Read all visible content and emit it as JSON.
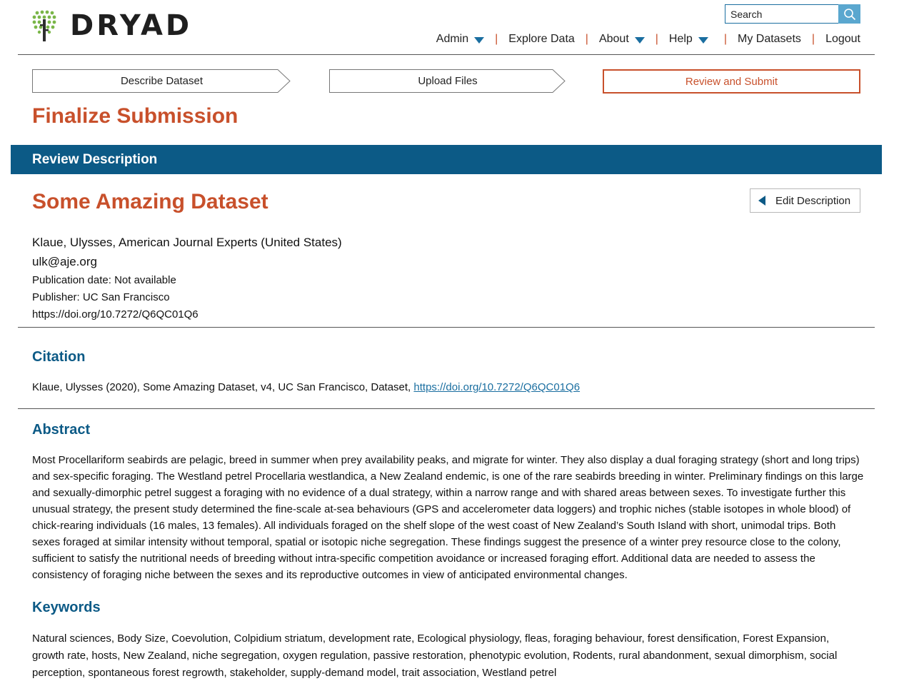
{
  "header": {
    "logo_text": "DRYAD",
    "search": {
      "placeholder": "Search"
    },
    "nav": {
      "admin": "Admin",
      "explore": "Explore Data",
      "about": "About",
      "help": "Help",
      "my_datasets": "My Datasets",
      "logout": "Logout"
    }
  },
  "steps": {
    "describe": "Describe Dataset",
    "upload": "Upload Files",
    "review": "Review and Submit"
  },
  "page_title": "Finalize Submission",
  "section_bar": "Review Description",
  "dataset": {
    "title": "Some Amazing Dataset",
    "edit_label": "Edit Description",
    "author": "Klaue, Ulysses, American Journal Experts (United States)",
    "email": "ulk@aje.org",
    "publication_date": "Publication date: Not available",
    "publisher": "Publisher: UC San Francisco",
    "doi": "https://doi.org/10.7272/Q6QC01Q6"
  },
  "citation": {
    "heading": "Citation",
    "text": "Klaue, Ulysses (2020), Some Amazing Dataset, v4, UC San Francisco, Dataset, ",
    "link": "https://doi.org/10.7272/Q6QC01Q6"
  },
  "abstract": {
    "heading": "Abstract",
    "text": "Most Procellariform seabirds are pelagic, breed in summer when prey availability peaks, and migrate for winter. They also display a dual foraging strategy (short and long trips) and sex-specific foraging. The Westland petrel Procellaria westlandica, a New Zealand endemic, is one of the rare seabirds breeding in winter. Preliminary findings on this large and sexually-dimorphic petrel suggest a foraging with no evidence of a dual strategy, within a narrow range and with shared areas between sexes. To investigate further this unusual strategy, the present study determined the fine-scale at-sea behaviours (GPS and accelerometer data loggers) and trophic niches (stable isotopes in whole blood) of chick-rearing individuals (16 males, 13 females). All individuals foraged on the shelf slope of the west coast of New Zealand’s South Island with short, unimodal trips. Both sexes foraged at similar intensity without temporal, spatial or isotopic niche segregation. These findings suggest the presence of a winter prey resource close to the colony, sufficient to satisfy the nutritional needs of breeding without intra-specific competition avoidance or increased foraging effort. Additional data are needed to assess the consistency of foraging niche between the sexes and its reproductive outcomes in view of anticipated environmental changes."
  },
  "keywords": {
    "heading": "Keywords",
    "text": "Natural sciences, Body Size, Coevolution, Colpidium striatum, development rate, Ecological physiology, fleas, foraging behaviour, forest densification, Forest Expansion, growth rate, hosts, New Zealand, niche segregation, oxygen regulation, passive restoration, phenotypic evolution, Rodents, rural abandonment, sexual dimorphism, social perception, spontaneous forest regrowth, stakeholder, supply-demand model, trait association, Westland petrel"
  },
  "colors": {
    "accent_orange": "#c8502b",
    "brand_blue": "#0c5a86",
    "link_blue": "#1a6ea0",
    "logo_green": "#7ab648"
  },
  "icons": [
    "dryad-tree-logo",
    "search-icon",
    "caret-down-icon",
    "caret-left-icon"
  ]
}
